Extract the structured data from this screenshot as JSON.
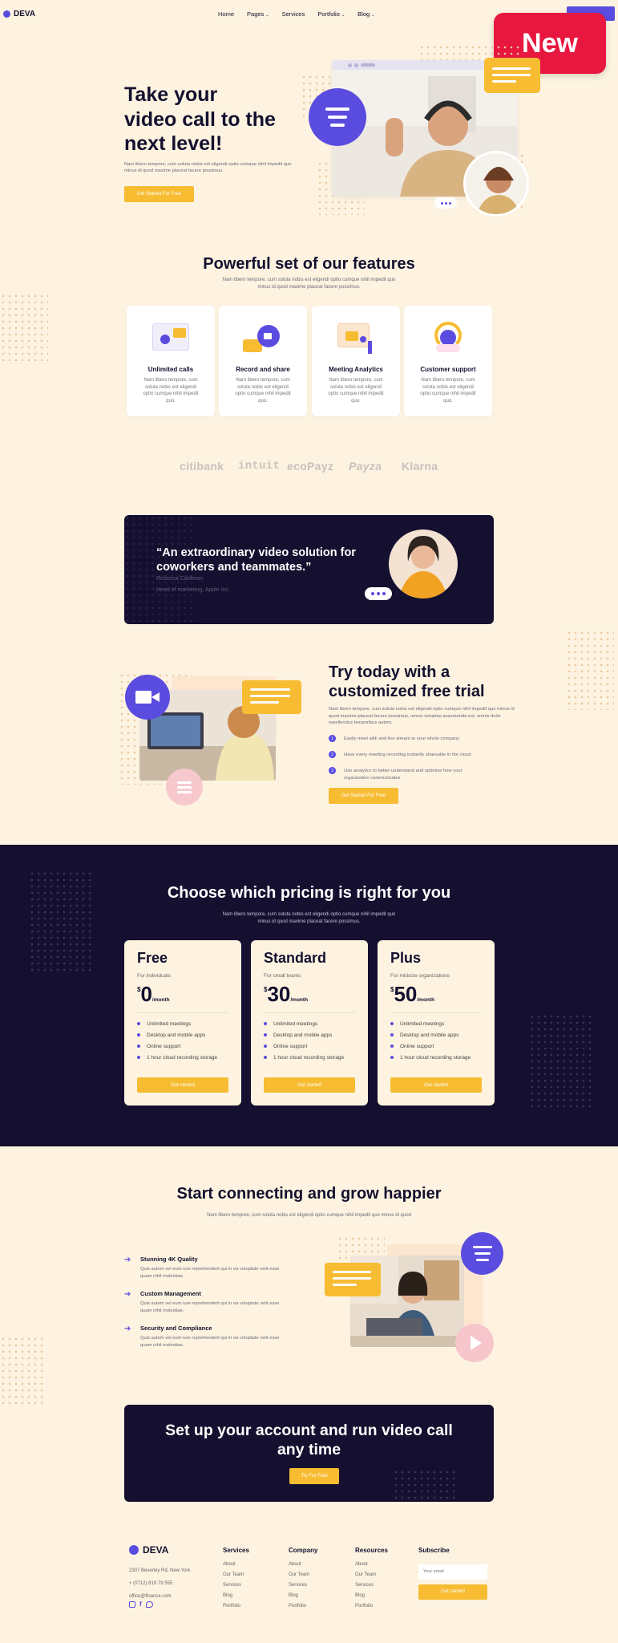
{
  "nav": {
    "logo": "DEVA",
    "menu": [
      "Home",
      "Pages",
      "Services",
      "Portfolio",
      "Blog"
    ],
    "badge": "New"
  },
  "hero": {
    "title_line1": "Take your",
    "title_line2": "video call to the",
    "title_line3": "next level!",
    "text": "Nam libero tempore, cum soluta nobis est eligendi optio cumque nihil impedit quo minus id quod maxime placeat facere possimus.",
    "cta": "Get Started For Free"
  },
  "features": {
    "title": "Powerful set of our features",
    "subtitle_line1": "Nam libero tempore, cum soluta nobis est eligendi optio cumque nihil impedit quo",
    "subtitle_line2": "minus id quod maxime placeat facere possimus.",
    "items": [
      {
        "title": "Unlimited calls",
        "desc": "Nam libero tempore, cum soluta nobis est eligendi optio cumque nihil impedit quo."
      },
      {
        "title": "Record and share",
        "desc": "Nam libero tempore, cum soluta nobis est eligendi optio cumque nihil impedit quo."
      },
      {
        "title": "Meeting Analytics",
        "desc": "Nam libero tempore, cum soluta nobis est eligendi optio cumque nihil impedit quo."
      },
      {
        "title": "Customer support",
        "desc": "Nam libero tempore, cum soluta nobis est eligendi optio cumque nihil impedit quo."
      }
    ]
  },
  "brands": [
    "citibank",
    "intuit",
    "ecoPayz",
    "Payza",
    "Klarna"
  ],
  "testimonial": {
    "quote_line1": "“An extraordinary video solution for",
    "quote_line2": "coworkers and teammates.”",
    "name": "Rebecca Calderon",
    "role": "Head of marketing, Apple Inc."
  },
  "trial": {
    "title_line1": "Try today with a",
    "title_line2": "customized free trial",
    "text": "Nam libero tempore, cum soluta nobis est eligendi optio cumque nihil impedit quo minus id quod maxime placeat facere possimus, omnis voluptas assumenda est, omnis dolor repellendus temporibus autem.",
    "steps": [
      {
        "num": "1",
        "text": "Easily meet with and live stream to your whole company"
      },
      {
        "num": "2",
        "text": "Have every meeting recording instantly shareable in the cloud"
      },
      {
        "num": "3",
        "text": "Use analytics to better understand and optimize how your organization communicates"
      }
    ],
    "cta": "Get Started For Free"
  },
  "pricing": {
    "title": "Choose which pricing is right for you",
    "subtitle_line1": "Nam libero tempore, cum soluta nobis est eligendi optio cumque nihil impedit quo",
    "subtitle_line2": "minus id quod maxime placeat facere possimus.",
    "plans": [
      {
        "name": "Free",
        "for": "For individuals",
        "currency": "$",
        "amount": "0",
        "period": "/month",
        "features": [
          "Unlimited meetings",
          "Desktop and mobile apps",
          "Online support",
          "1 hour cloud recording storage"
        ],
        "cta": "Get started"
      },
      {
        "name": "Standard",
        "for": "For small teams",
        "currency": "$",
        "amount": "30",
        "period": "/month",
        "features": [
          "Unlimited meetings",
          "Desktop and mobile apps",
          "Online support",
          "1 hour cloud recording storage"
        ],
        "cta": "Get started"
      },
      {
        "name": "Plus",
        "for": "For midsize organizations",
        "currency": "$",
        "amount": "50",
        "period": "/month",
        "features": [
          "Unlimited meetings",
          "Desktop and mobile apps",
          "Online support",
          "1 hour cloud recording storage"
        ],
        "cta": "Get started"
      }
    ]
  },
  "connect": {
    "title": "Start connecting and grow happier",
    "subtitle": "Nam libero tempore, cum soluta nobis est eligendi optio cumque nihil impedit quo minus id quod",
    "items": [
      {
        "title": "Stunning 4K Quality",
        "desc_line1": "Quis autem vel eum iure reprehenderit qui in ea voluptate velit esse",
        "desc_line2": "quam nihil molestiae."
      },
      {
        "title": "Custom Management",
        "desc_line1": "Quis autem vel eum iure reprehenderit qui in ea voluptate velit esse",
        "desc_line2": "quam nihil molestiae."
      },
      {
        "title": "Security and Compliance",
        "desc_line1": "Quis autem vel eum iure reprehenderit qui in ea voluptate velit esse",
        "desc_line2": "quam nihil molestiae."
      }
    ]
  },
  "cta_banner": {
    "title_line1": "Set up your account and run video call",
    "title_line2": "any time",
    "cta": "Try For Free"
  },
  "footer": {
    "logo": "DEVA",
    "address": "2307 Beverley Rd, New York",
    "phone": "+ (0712) 819 79 555",
    "email": "office@finance.com",
    "columns": [
      {
        "title": "Services",
        "links": [
          "About",
          "Our Team",
          "Services",
          "Blog",
          "Portfolio"
        ]
      },
      {
        "title": "Company",
        "links": [
          "About",
          "Our Team",
          "Services",
          "Blog",
          "Portfolio"
        ]
      },
      {
        "title": "Resources",
        "links": [
          "About",
          "Our Team",
          "Services",
          "Blog",
          "Portfolio"
        ]
      }
    ],
    "subscribe_title": "Subscribe",
    "email_placeholder": "Your email",
    "subscribe_cta": "Get started"
  },
  "colors": {
    "accent": "#5b4ce0",
    "yellow": "#f7bc32",
    "dark": "#15102f",
    "bg": "#fdf3e0",
    "badge": "#e8173f"
  }
}
